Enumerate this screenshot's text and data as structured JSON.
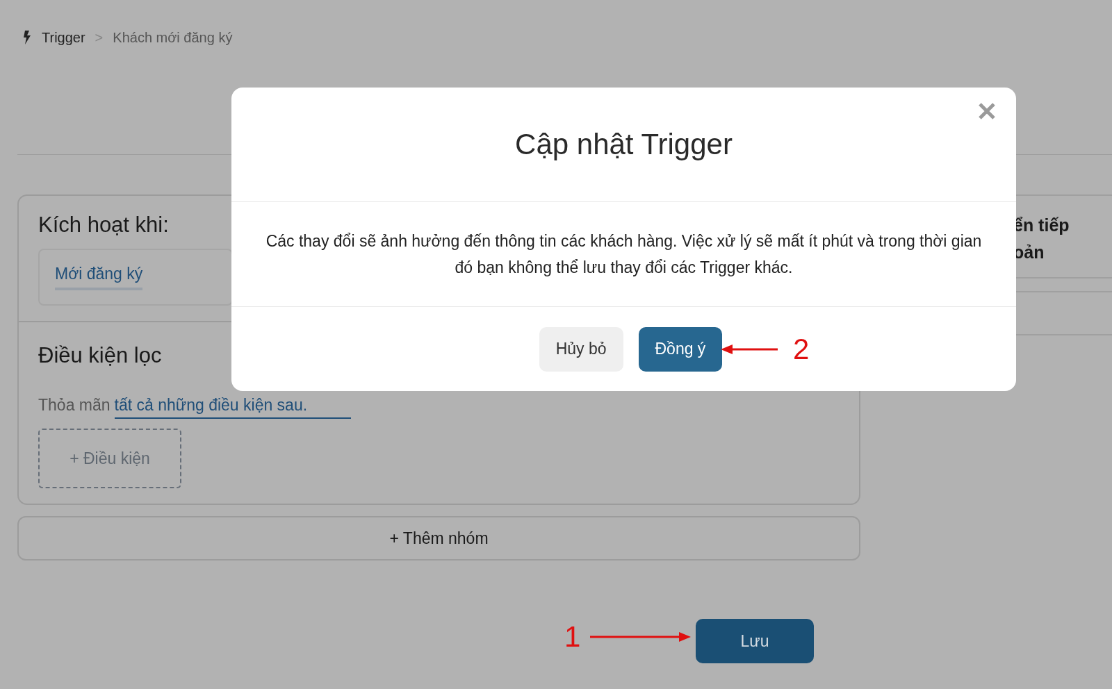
{
  "breadcrumb": {
    "items": [
      {
        "label": "Trigger"
      },
      {
        "label": "Khách mới đăng ký"
      }
    ],
    "separator": ">"
  },
  "trigger_card": {
    "heading": "Kích hoạt khi:",
    "trigger_tab": "Mới đăng ký",
    "filter_heading": "Điều kiện lọc",
    "match_prefix": "Thỏa mãn",
    "match_link": "tất cả những điều kiện sau.",
    "add_condition": "+ Điều kiện"
  },
  "add_group": "+ Thêm nhóm",
  "side_panel": {
    "lines": [
      "ển tiếp",
      "oản"
    ]
  },
  "save_button": "Lưu",
  "modal": {
    "title": "Cập nhật Trigger",
    "message": "Các thay đổi sẽ ảnh hưởng đến thông tin các khách hàng. Việc xử lý sẽ mất ít phút và trong thời gian đó bạn không thể lưu thay đổi các Trigger khác.",
    "buttons": [
      {
        "label": "Hủy bỏ",
        "kind": "secondary"
      },
      {
        "label": "Đồng ý",
        "kind": "primary"
      }
    ]
  },
  "annotations": [
    {
      "label": "1"
    },
    {
      "label": "2"
    }
  ]
}
